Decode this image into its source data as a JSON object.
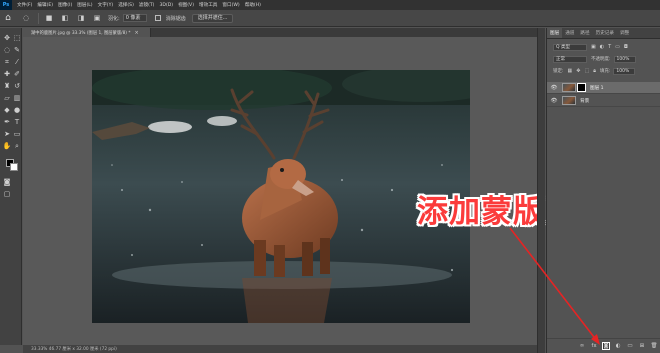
{
  "menubar": {
    "logo": "Ps",
    "items": [
      "文件(F)",
      "编辑(E)",
      "图像(I)",
      "图层(L)",
      "文字(Y)",
      "选择(S)",
      "滤镜(T)",
      "3D(D)",
      "视图(V)",
      "增效工具",
      "窗口(W)",
      "帮助(H)"
    ]
  },
  "options": {
    "feather_label": "羽化:",
    "feather_value": "0 像素",
    "antialias_label": "消除锯齿",
    "select_mask_button": "选择并遮住..."
  },
  "document": {
    "tab_title": "湖中的鹿图片.jpg @ 33.3% (图层 1, 图层蒙版/8) *",
    "close_glyph": "×",
    "status": "33.33%   46.77 厘米 x 32.00 厘米 (72 ppi)"
  },
  "callout": {
    "text": "添加蒙版",
    "color": "#fb3b3b"
  },
  "layers_panel": {
    "tabs": [
      "图层",
      "通道",
      "路径",
      "历史记录",
      "调整"
    ],
    "active_tab": "图层",
    "kind_filter": "Q 类型",
    "blend_mode": "正常",
    "opacity_label": "不透明度:",
    "opacity_value": "100%",
    "lock_label": "锁定:",
    "fill_label": "填充:",
    "fill_value": "100%",
    "layers": [
      {
        "name": "图层 1",
        "selected": true,
        "has_mask": true
      },
      {
        "name": "背景",
        "selected": false,
        "has_mask": false
      }
    ]
  },
  "icons": {
    "eye": "eye-icon",
    "add_mask": "add-layer-mask-icon"
  }
}
